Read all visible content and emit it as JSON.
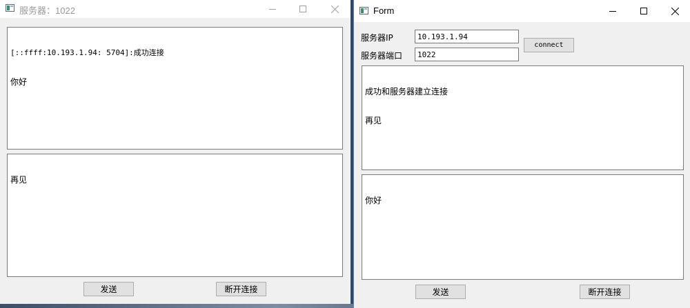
{
  "server_window": {
    "title": "服务器：1022",
    "received_lines": [
      "[::ffff:10.193.1.94: 5704]:成功连接",
      "你好"
    ],
    "send_text": "再见",
    "send_button": "发送",
    "disconnect_button": "断开连接"
  },
  "client_window": {
    "title": "Form",
    "server_ip_label": "服务器IP",
    "server_ip_value": "10.193.1.94",
    "server_port_label": "服务器端口",
    "server_port_value": "1022",
    "connect_button": "connect",
    "received_lines": [
      "成功和服务器建立连接",
      "再见"
    ],
    "send_text": "你好",
    "send_button": "发送",
    "disconnect_button": "断开连接"
  }
}
